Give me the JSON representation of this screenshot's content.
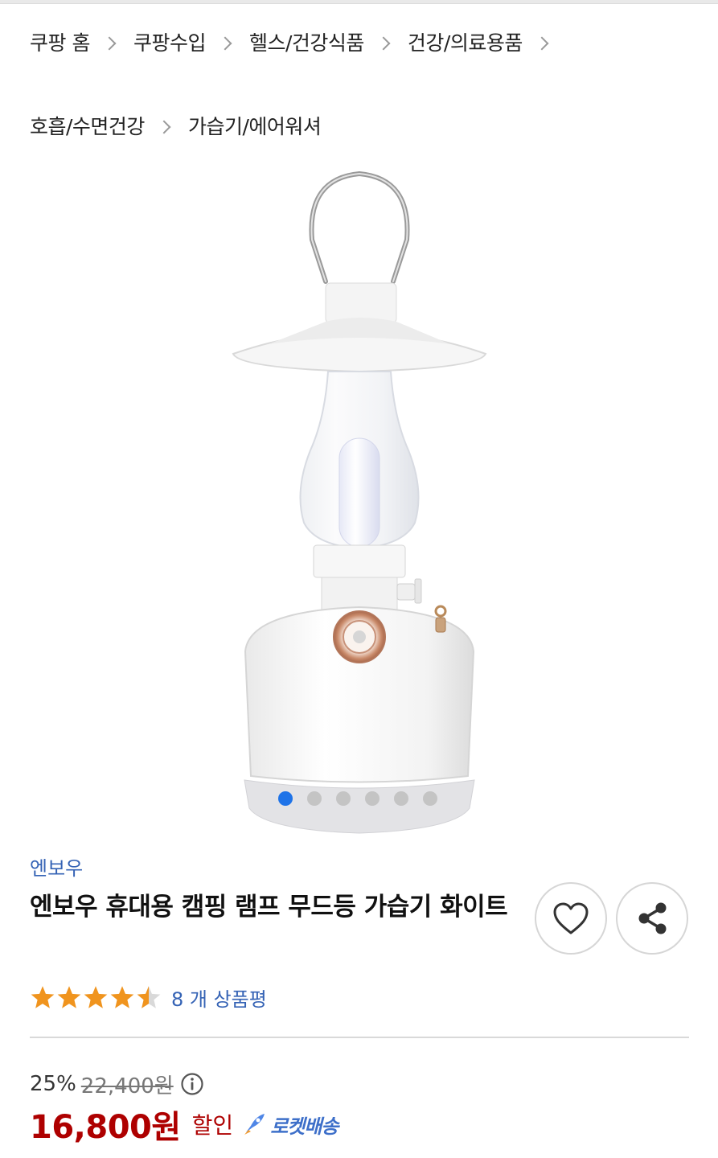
{
  "breadcrumb": {
    "items": [
      "쿠팡 홈",
      "쿠팡수입",
      "헬스/건강식품",
      "건강/의료용품",
      "호흡/수면건강",
      "가습기/에어워셔"
    ]
  },
  "gallery": {
    "image_count": 6,
    "active_index": 0
  },
  "product": {
    "brand": "엔보우",
    "title": "엔보우 휴대용 캠핑 램프 무드등 가습기 화이트",
    "rating": 4.5,
    "review_count": "8 개 상품평"
  },
  "price": {
    "discount_rate": "25%",
    "original_price": "22,400원",
    "sale_price": "16,800원",
    "sale_label": "할인",
    "delivery_badge": "로켓배송"
  },
  "colors": {
    "accent_blue": "#3563b5",
    "price_red": "#ae0000",
    "star": "#f0941e",
    "dot_active": "#1e73e8"
  },
  "icons": {
    "wishlist": "heart-icon",
    "share": "share-icon",
    "info": "info-icon",
    "separator": "chevron-right-icon",
    "delivery": "rocket-icon"
  }
}
